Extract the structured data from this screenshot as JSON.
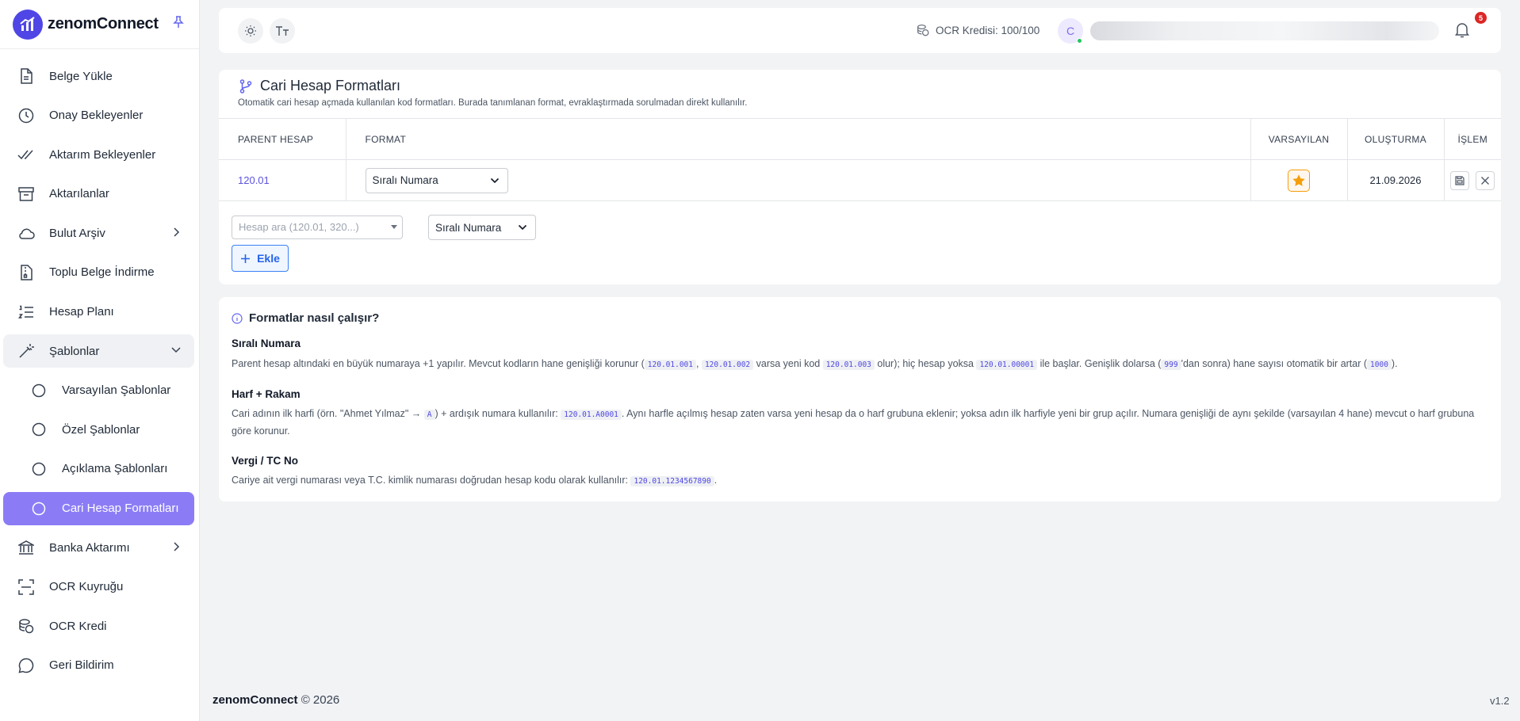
{
  "brand": {
    "name": "zenomConnect"
  },
  "sidebar": {
    "items": [
      {
        "label": "Belge Yükle",
        "icon": "file-upload-icon"
      },
      {
        "label": "Onay Bekleyenler",
        "icon": "clock-icon"
      },
      {
        "label": "Aktarım Bekleyenler",
        "icon": "double-check-icon"
      },
      {
        "label": "Aktarılanlar",
        "icon": "archive-icon"
      },
      {
        "label": "Bulut Arşiv",
        "icon": "cloud-icon",
        "expandable": true
      },
      {
        "label": "Toplu Belge İndirme",
        "icon": "zip-file-icon"
      },
      {
        "label": "Hesap Planı",
        "icon": "list-ordered-icon"
      },
      {
        "label": "Şablonlar",
        "icon": "magic-wand-icon",
        "expanded": true
      },
      {
        "label": "Varsayılan Şablonlar",
        "sub": true
      },
      {
        "label": "Özel Şablonlar",
        "sub": true
      },
      {
        "label": "Açıklama Şablonları",
        "sub": true
      },
      {
        "label": "Cari Hesap Formatları",
        "sub": true,
        "active": true
      },
      {
        "label": "Banka Aktarımı",
        "icon": "bank-icon",
        "expandable": true
      },
      {
        "label": "OCR Kuyruğu",
        "icon": "scan-icon"
      },
      {
        "label": "OCR Kredi",
        "icon": "coins-icon"
      },
      {
        "label": "Geri Bildirim",
        "icon": "chat-icon"
      }
    ]
  },
  "header": {
    "ocr_credit": "OCR Kredisi: 100/100",
    "avatar_initial": "C",
    "notification_count": "5"
  },
  "page": {
    "title": "Cari Hesap Formatları",
    "subtitle": "Otomatik cari hesap açmada kullanılan kod formatları. Burada tanımlanan format, evraklaştırmada sorulmadan direkt kullanılır."
  },
  "table": {
    "columns": [
      "PARENT HESAP",
      "FORMAT",
      "VARSAYILAN",
      "OLUŞTURMA",
      "İŞLEM"
    ],
    "rows": [
      {
        "parent": "120.01",
        "format": "Sıralı Numara",
        "default": true,
        "created": "21.09.2026"
      }
    ]
  },
  "add_form": {
    "search_placeholder": "Hesap ara (120.01, 320...)",
    "format_value": "Sıralı Numara",
    "add_label": "Ekle"
  },
  "info": {
    "title": "Formatlar nasıl çalışır?",
    "s1": {
      "heading": "Sıralı Numara",
      "t1": "Parent hesap altındaki en büyük numaraya +1 yapılır. Mevcut kodların hane genişliği korunur (",
      "c1": "120.01.001",
      "t2": ", ",
      "c2": "120.01.002",
      "t3": " varsa yeni kod ",
      "c3": "120.01.003",
      "t4": " olur); hiç hesap yoksa ",
      "c4": "120.01.00001",
      "t5": " ile başlar. Genişlik dolarsa (",
      "c5": "999",
      "t6": "'dan sonra) hane sayısı otomatik bir artar (",
      "c6": "1000",
      "t7": ")."
    },
    "s2": {
      "heading": "Harf + Rakam",
      "t1": "Cari adının ilk harfi (örn. \"Ahmet Yılmaz\" → ",
      "c1": "A",
      "t2": ") + ardışık numara kullanılır: ",
      "c2": "120.01.A0001",
      "t3": ". Aynı harfle açılmış hesap zaten varsa yeni hesap da o harf grubuna eklenir; yoksa adın ilk harfiyle yeni bir grup açılır. Numara genişliği de aynı şekilde (varsayılan 4 hane) mevcut o harf grubuna göre korunur."
    },
    "s3": {
      "heading": "Vergi / TC No",
      "t1": "Cariye ait vergi numarası veya T.C. kimlik numarası doğrudan hesap kodu olarak kullanılır: ",
      "c1": "120.01.1234567890",
      "t2": "."
    }
  },
  "footer": {
    "brand": "zenomConnect",
    "copyright": "© 2026",
    "version": "v1.2"
  }
}
